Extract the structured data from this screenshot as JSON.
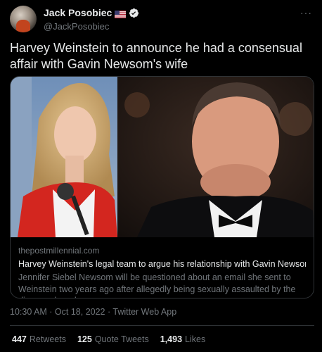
{
  "author": {
    "display_name": "Jack Posobiec",
    "handle": "@JackPosobiec",
    "flag_icon": "us-flag-icon",
    "verified_icon": "verified-badge-icon",
    "verified_color": "#1d9bf0"
  },
  "more_label": "···",
  "tweet": {
    "text": "Harvey Weinstein to announce he had a consensual affair with Gavin Newsom's wife"
  },
  "card": {
    "domain": "thepostmillennial.com",
    "title": "Harvey Weinstein's legal team to argue his relationship with Gavin Newsom's wi...",
    "description": "Jennifer Siebel Newsom will be questioned about an email she sent to Weinstein two years ago after allegedly being sexually assaulted by the disgraced producer."
  },
  "timestamp": "10:30 AM · Oct 18, 2022 · Twitter Web App",
  "stats": [
    {
      "num": "447",
      "label": "Retweets"
    },
    {
      "num": "125",
      "label": "Quote Tweets"
    },
    {
      "num": "1,493",
      "label": "Likes"
    }
  ],
  "colors": {
    "background": "#000000",
    "text_primary": "#e7e9ea",
    "text_secondary": "#71767b",
    "border": "#2f3336"
  }
}
